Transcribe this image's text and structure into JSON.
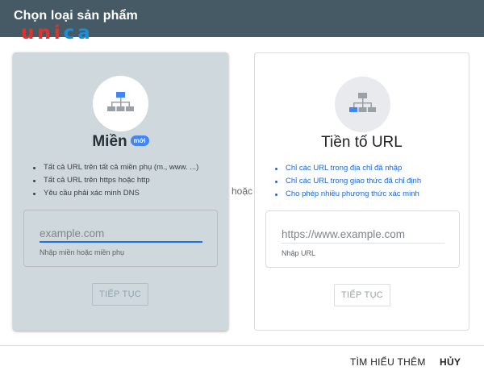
{
  "dialog": {
    "title": "Chọn loại sản phẩm"
  },
  "logo": {
    "letter_1": "u",
    "letters_mid": "ni",
    "letters_end": "ca"
  },
  "domain_card": {
    "title": "Miền",
    "badge": "mới",
    "icon": "sitemap-icon",
    "bullets": [
      "Tất cả URL trên tất cả miền phụ (m., www. ...)",
      "Tất cả URL trên https hoặc http",
      "Yêu cầu phải xác minh DNS"
    ],
    "input_placeholder": "example.com",
    "input_hint": "Nhập miền hoặc miền phụ",
    "button_label": "TIẾP TỤC"
  },
  "separator": "hoặc",
  "prefix_card": {
    "title": "Tiền tố URL",
    "icon": "sitemap-icon",
    "bullets": [
      "Chỉ các URL trong địa chỉ đã nhập",
      "Chỉ các URL trong giao thức đã chỉ định",
      "Cho phép nhiều phương thức xác minh"
    ],
    "input_placeholder": "https://www.example.com",
    "input_hint": "Nhập URL",
    "button_label": "TIẾP TỤC"
  },
  "footer": {
    "learn_more": "TÌM HIỂU THÊM",
    "cancel": "HỦY"
  },
  "colors": {
    "titlebar": "#455a64",
    "accent": "#1a73e8",
    "badge": "#4285f4",
    "card_selected": "#cfd8dc"
  }
}
